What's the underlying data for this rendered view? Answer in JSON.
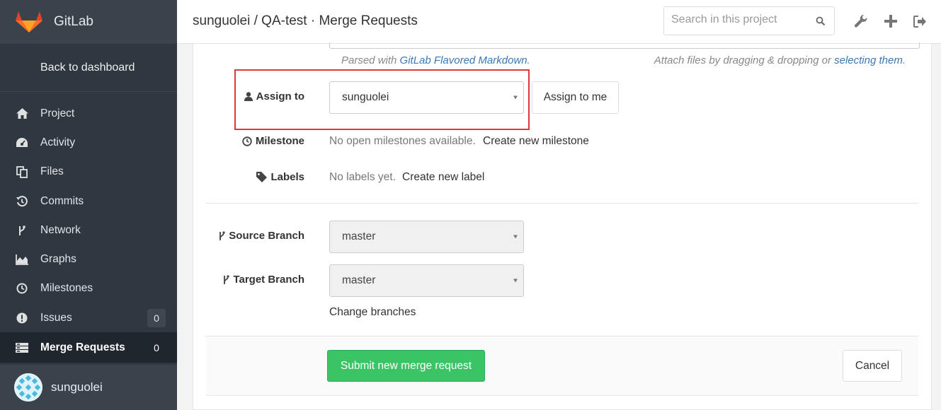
{
  "brand": {
    "name": "GitLab"
  },
  "sidebar": {
    "back_label": "Back to dashboard",
    "items": [
      {
        "label": "Project",
        "icon": "home-icon"
      },
      {
        "label": "Activity",
        "icon": "dashboard-icon"
      },
      {
        "label": "Files",
        "icon": "files-icon"
      },
      {
        "label": "Commits",
        "icon": "history-icon"
      },
      {
        "label": "Network",
        "icon": "branch-icon"
      },
      {
        "label": "Graphs",
        "icon": "area-chart-icon"
      },
      {
        "label": "Milestones",
        "icon": "clock-icon"
      },
      {
        "label": "Issues",
        "icon": "exclamation-circle-icon",
        "count": "0"
      },
      {
        "label": "Merge Requests",
        "icon": "tasks-icon",
        "count": "0",
        "active": true
      }
    ],
    "user": {
      "name": "sunguolei"
    }
  },
  "header": {
    "title": "sunguolei / QA-test · Merge Requests",
    "search_placeholder": "Search in this project"
  },
  "form": {
    "hint_parsed_prefix": "Parsed with ",
    "hint_parsed_link": "GitLab Flavored Markdown",
    "hint_parsed_suffix": ".",
    "hint_attach_prefix": "Attach files by dragging & dropping or ",
    "hint_attach_link": "selecting them",
    "hint_attach_suffix": ".",
    "assign_label": "Assign to",
    "assign_value": "sunguolei",
    "assign_me_button": "Assign to me",
    "milestone_label": "Milestone",
    "milestone_text": "No open milestones available.",
    "milestone_link": "Create new milestone",
    "labels_label": "Labels",
    "labels_text": "No labels yet.",
    "labels_link": "Create new label",
    "source_label": "Source Branch",
    "source_value": "master",
    "target_label": "Target Branch",
    "target_value": "master",
    "change_branches": "Change branches",
    "submit_button": "Submit new merge request",
    "cancel_button": "Cancel"
  },
  "colors": {
    "sidebar_bg": "#2f3740",
    "submit_green": "#3bc466",
    "link_blue": "#3a78b5",
    "highlight_red": "#e0373a"
  }
}
